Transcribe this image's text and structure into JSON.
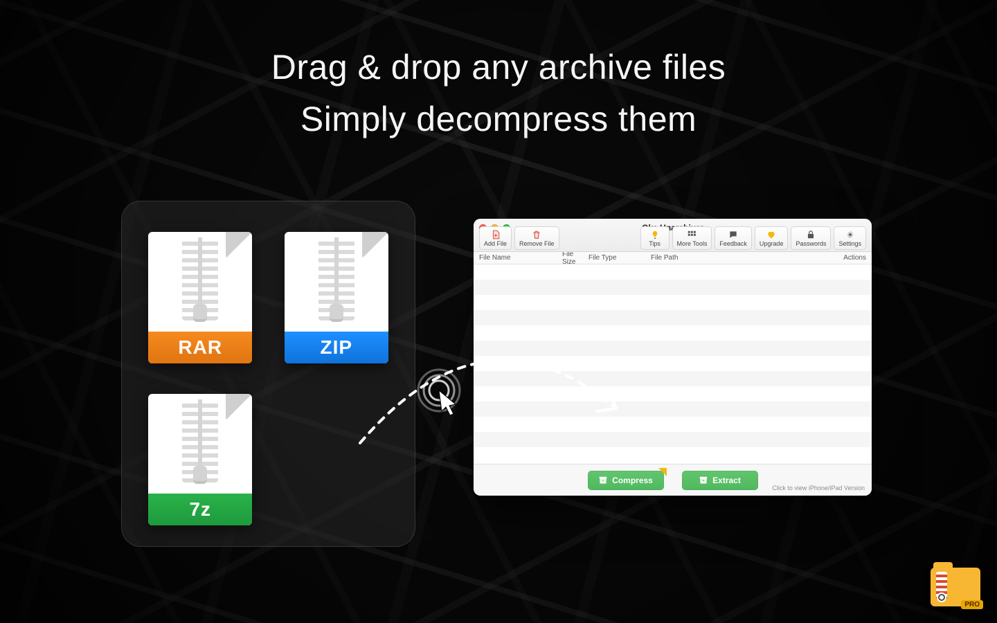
{
  "headline": {
    "line1": "Drag & drop any archive files",
    "line2": "Simply decompress them"
  },
  "archives": {
    "rar": "RAR",
    "zip": "ZIP",
    "sevenz": "7z"
  },
  "colors": {
    "rar": "#f58a1f",
    "zip": "#1e90ff",
    "sevenz": "#2ab24a",
    "action_green": "#54bd62"
  },
  "app": {
    "title": "Oka Unarchiver",
    "toolbar_left": {
      "add_file": "Add File",
      "remove_file": "Remove File"
    },
    "toolbar_right": {
      "tips": "Tips",
      "more_tools": "More Tools",
      "feedback": "Feedback",
      "upgrade": "Upgrade",
      "passwords": "Passwords",
      "settings": "Settings"
    },
    "columns": {
      "file_name": "File Name",
      "file_size": "File Size",
      "file_type": "File Type",
      "file_path": "File Path",
      "actions": "Actions"
    },
    "rows": [],
    "footer": {
      "compress": "Compress",
      "extract": "Extract",
      "hint": "Click to view iPhone/iPad Version"
    }
  },
  "pro_badge": "PRO",
  "icons": {
    "add_file": "plus-doc-icon",
    "remove_file": "trash-icon",
    "tips": "lightbulb-icon",
    "more_tools": "grid-icon",
    "feedback": "chat-bubble-icon",
    "upgrade": "heart-icon",
    "passwords": "lock-icon",
    "settings": "gear-icon",
    "compress": "archive-icon",
    "extract": "archive-icon"
  }
}
